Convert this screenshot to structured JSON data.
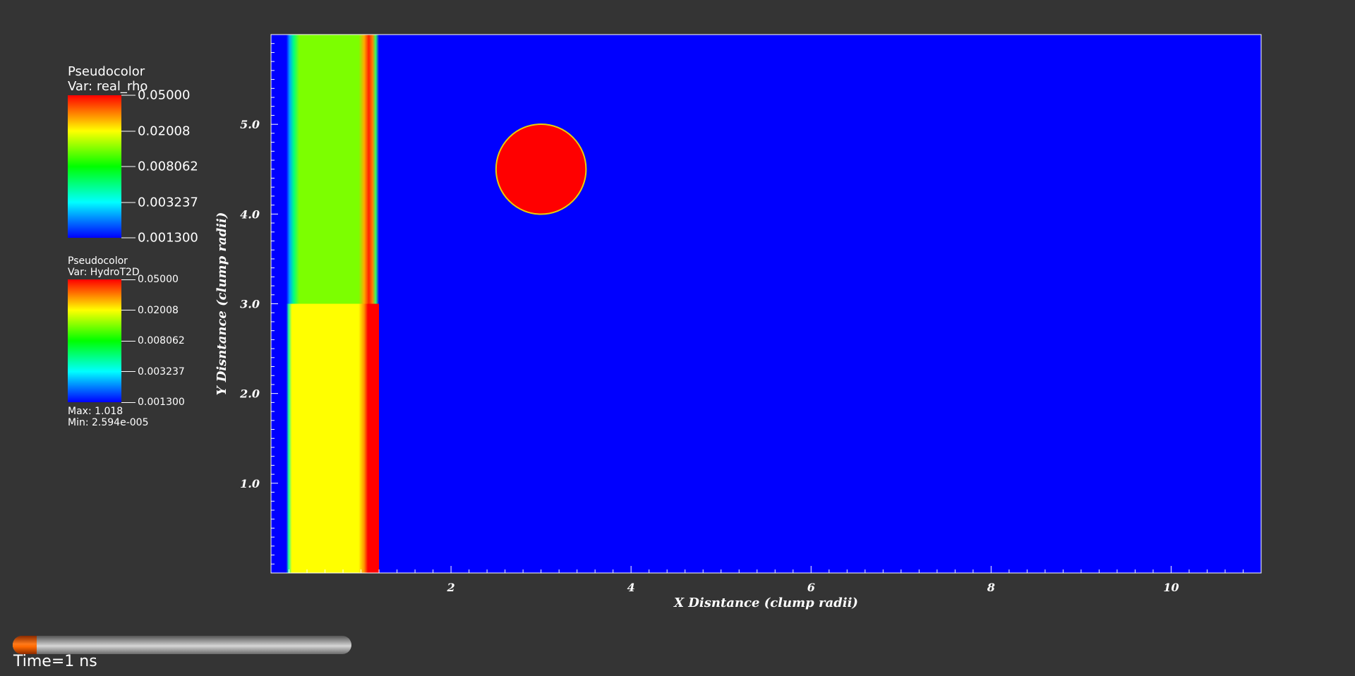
{
  "legends": [
    {
      "title": "Pseudocolor",
      "var_label": "Var: real_rho",
      "ticks": [
        "0.05000",
        "0.02008",
        "0.008062",
        "0.003237",
        "0.001300"
      ]
    },
    {
      "title": "Pseudocolor",
      "var_label": "Var: HydroT2D",
      "ticks": [
        "0.05000",
        "0.02008",
        "0.008062",
        "0.003237",
        "0.001300"
      ],
      "max_label": "Max:  1.018",
      "min_label": "Min:  2.594e-005"
    }
  ],
  "colors": {
    "background": "#343434",
    "field_low": "#0000ff",
    "field_high": "#ff0000",
    "shell": "#7cff00",
    "slab": "#ffff00"
  },
  "chart_data": {
    "type": "heatmap",
    "xlabel": "X Disntance (clump radii)",
    "ylabel": "Y Disntance (clump radii)",
    "xlim": [
      0,
      11
    ],
    "ylim": [
      0,
      6
    ],
    "x_ticks": [
      "2",
      "4",
      "6",
      "8",
      "10"
    ],
    "x_tick_values": [
      2,
      4,
      6,
      8,
      10
    ],
    "y_ticks": [
      "1.0",
      "2.0",
      "3.0",
      "4.0",
      "5.0"
    ],
    "y_tick_values": [
      1,
      2,
      3,
      4,
      5
    ],
    "background_value": "low",
    "regions": [
      {
        "name": "upper-shock-slab",
        "shape": "band",
        "x_start": 0.17,
        "x_end": 1.2,
        "y_start": 3.0,
        "y_end": 6.0
      },
      {
        "name": "lower-shock-slab",
        "shape": "band",
        "x_start": 0.17,
        "x_end": 1.2,
        "y_start": 0.0,
        "y_end": 3.0
      },
      {
        "name": "dense-clump",
        "shape": "circle",
        "cx": 3.0,
        "cy": 4.5,
        "r": 0.5
      }
    ]
  },
  "time_slider": {
    "progress": 0.07,
    "label": "Time=1 ns"
  }
}
